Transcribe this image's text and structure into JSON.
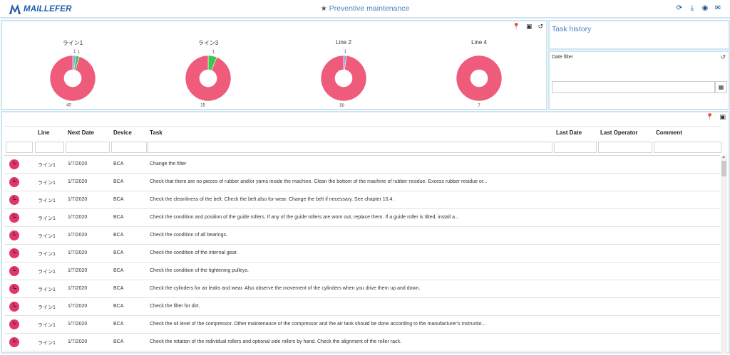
{
  "header": {
    "brand": "MAILLEFER",
    "title": "Preventive maintenance",
    "title_icon": "star-icon",
    "icons": [
      "refresh-icon",
      "download-icon",
      "eye-icon",
      "chat-icon"
    ]
  },
  "colors": {
    "accent": "#4b80c0",
    "brand": "#1f5da8",
    "overdue": "#ef5b7b",
    "ok": "#3cc84f",
    "other": "#8ea4e8",
    "status_dot": "#e2366a"
  },
  "charts": [
    {
      "label": "ライン1",
      "segments": [
        {
          "value": 1,
          "color": "#8ea4e8"
        },
        {
          "value": 1,
          "color": "#3cc84f"
        },
        {
          "value": 40,
          "color": "#ef5b7b"
        }
      ],
      "labels": [
        "1",
        "1",
        "40"
      ]
    },
    {
      "label": "ライン3",
      "segments": [
        {
          "value": 1,
          "color": "#3cc84f"
        },
        {
          "value": 15,
          "color": "#ef5b7b"
        }
      ],
      "labels": [
        "1",
        "15"
      ]
    },
    {
      "label": "Line 2",
      "segments": [
        {
          "value": 1,
          "color": "#8ea4e8"
        },
        {
          "value": 50,
          "color": "#ef5b7b"
        }
      ],
      "labels": [
        "1",
        "50"
      ]
    },
    {
      "label": "Line 4",
      "segments": [
        {
          "value": 7,
          "color": "#ef5b7b"
        }
      ],
      "labels": [
        "7"
      ]
    }
  ],
  "task_history": {
    "title": "Task history"
  },
  "date_filter": {
    "title": "Date filter",
    "value": ""
  },
  "table": {
    "columns": {
      "line": "Line",
      "next_date": "Next Date",
      "device": "Device",
      "task": "Task",
      "last_date": "Last Date",
      "last_operator": "Last Operator",
      "comment": "Comment"
    },
    "rows": [
      {
        "line": "ライン1",
        "next_date": "1/7/2020",
        "device": "BCA",
        "task": "Change the filter"
      },
      {
        "line": "ライン1",
        "next_date": "1/7/2020",
        "device": "BCA",
        "task": "Check that there are no pieces of rubber and/or yarns inside the machine. Clean the bottom of the machine of rubber residue. Excess rubber residue or..."
      },
      {
        "line": "ライン1",
        "next_date": "1/7/2020",
        "device": "BCA",
        "task": "Check the cleanliness of the belt. Check the belt also for wear. Change the belt if necessary. See chapter 10.4."
      },
      {
        "line": "ライン1",
        "next_date": "1/7/2020",
        "device": "BCA",
        "task": "Check the condition and position of the guide rollers. If any of the guide rollers are worn out, replace them. If a guide roller is tilted, install a..."
      },
      {
        "line": "ライン1",
        "next_date": "1/7/2020",
        "device": "BCA",
        "task": "Check the condition of all bearings."
      },
      {
        "line": "ライン1",
        "next_date": "1/7/2020",
        "device": "BCA",
        "task": "Check the condition of the internal gear."
      },
      {
        "line": "ライン1",
        "next_date": "1/7/2020",
        "device": "BCA",
        "task": "Check the condition of the tightening pulleys."
      },
      {
        "line": "ライン1",
        "next_date": "1/7/2020",
        "device": "BCA",
        "task": "Check the cylinders for air leaks and wear. Also observe the movement of the cylinders when you drive them up and down."
      },
      {
        "line": "ライン1",
        "next_date": "1/7/2020",
        "device": "BCA",
        "task": "Check the filter for dirt."
      },
      {
        "line": "ライン1",
        "next_date": "1/7/2020",
        "device": "BCA",
        "task": "Check the oil level of the compressor. Other maintenance of the compressor and the air tank should be done according to the manufacturer's instructio..."
      },
      {
        "line": "ライン1",
        "next_date": "1/7/2020",
        "device": "BCA",
        "task": "Check the rotation of the individual rollers and optional side rollers by hand. Check the alignment of the roller rack."
      }
    ]
  }
}
